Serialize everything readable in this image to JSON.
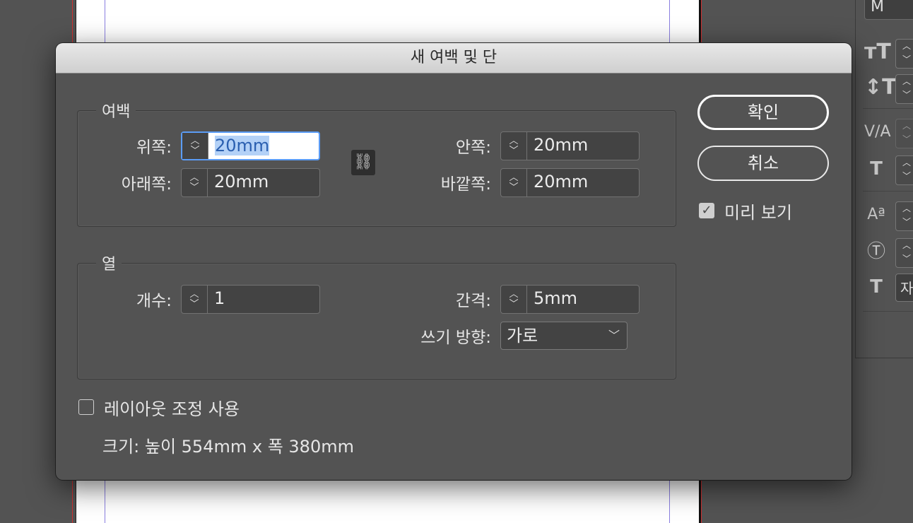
{
  "dialog": {
    "title": "새 여백 및 단",
    "margins": {
      "label": "여백",
      "top_label": "위쪽:",
      "top_value": "20mm",
      "bottom_label": "아래쪽:",
      "bottom_value": "20mm",
      "inside_label": "안쪽:",
      "inside_value": "20mm",
      "outside_label": "바깥쪽:",
      "outside_value": "20mm"
    },
    "columns": {
      "label": "열",
      "count_label": "개수:",
      "count_value": "1",
      "gutter_label": "간격:",
      "gutter_value": "5mm",
      "direction_label": "쓰기 방향:",
      "direction_value": "가로"
    },
    "layout_adjust_label": "레이아웃 조정 사용",
    "layout_adjust_checked": false,
    "size_text": "크기: 높이 554mm x 폭 380mm",
    "ok_label": "확인",
    "cancel_label": "취소",
    "preview_label": "미리 보기",
    "preview_checked": true
  },
  "panel": {
    "top_field": "M",
    "bottom_field": "자"
  }
}
